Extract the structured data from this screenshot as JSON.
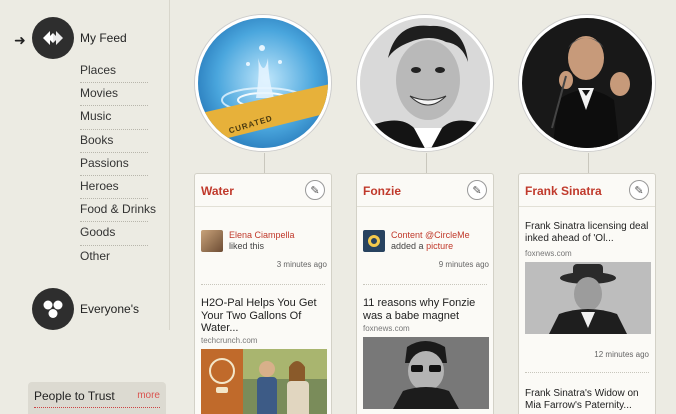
{
  "sidebar": {
    "main_nav": [
      {
        "label": "My Feed",
        "icon": "my-feed-icon",
        "active": true
      },
      {
        "label": "Everyone's",
        "icon": "everyones-icon",
        "active": false
      }
    ],
    "categories": [
      "Places",
      "Movies",
      "Music",
      "Books",
      "Passions",
      "Heroes",
      "Food & Drinks",
      "Goods",
      "Other"
    ],
    "people_panel": {
      "title": "People to Trust",
      "more_label": "more"
    }
  },
  "columns": [
    {
      "title": "Water",
      "image": "water-splash-image",
      "badge": "CURATED",
      "activity": {
        "user": "Elena Ciampella",
        "verb": "liked this",
        "link": "",
        "time": "3 minutes ago"
      },
      "article": {
        "headline": "H2O-Pal Helps You Get Your Two Gallons Of Water...",
        "source": "techcrunch.com",
        "time": ""
      }
    },
    {
      "title": "Fonzie",
      "image": "fonzie-portrait-image",
      "badge": "",
      "activity": {
        "user": "Content @CircleMe",
        "verb": "added a",
        "link": "picture",
        "time": "9 minutes ago"
      },
      "article": {
        "headline": "11 reasons why Fonzie was a babe magnet",
        "source": "foxnews.com",
        "time": ""
      }
    },
    {
      "title": "Frank Sinatra",
      "image": "frank-sinatra-portrait-image",
      "badge": "",
      "activity": null,
      "article": {
        "headline": "Frank Sinatra licensing deal inked ahead of 'Ol...",
        "source": "foxnews.com",
        "time": "12 minutes ago"
      },
      "article2": {
        "headline": "Frank Sinatra's Widow on Mia Farrow's Paternity..."
      }
    }
  ],
  "colors": {
    "accent": "#c0392b",
    "background": "#ecebe3",
    "card": "#fbfaf6",
    "icon_circle": "#2e2e2e"
  }
}
